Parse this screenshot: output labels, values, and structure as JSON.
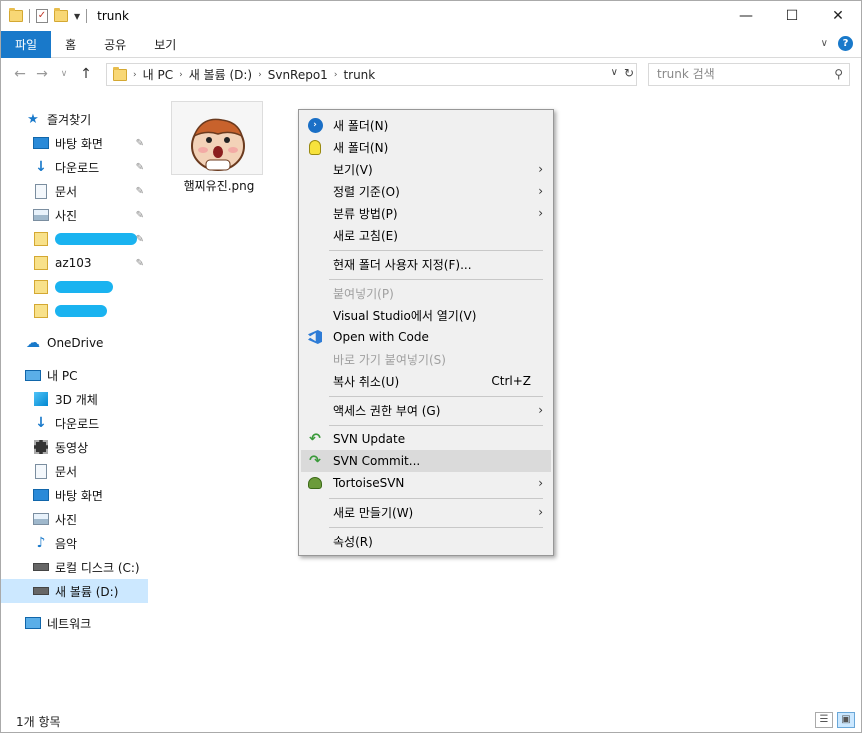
{
  "window": {
    "title": "trunk",
    "controls": {
      "minimize": "—",
      "maximize": "☐",
      "close": "✕"
    }
  },
  "ribbon": {
    "tabs": [
      {
        "label": "파일",
        "active": true
      },
      {
        "label": "홈"
      },
      {
        "label": "공유"
      },
      {
        "label": "보기"
      }
    ],
    "help_label": "?"
  },
  "address": {
    "path": [
      "내 PC",
      "새 볼륨 (D:)",
      "SvnRepo1",
      "trunk"
    ]
  },
  "search": {
    "placeholder": "trunk 검색"
  },
  "sidebar": {
    "quick_access": "즐겨찾기",
    "quick_items": [
      {
        "label": "바탕 화면",
        "icon": "desktop-icon",
        "pinned": true
      },
      {
        "label": "다운로드",
        "icon": "download-icon",
        "pinned": true
      },
      {
        "label": "문서",
        "icon": "document-icon",
        "pinned": true
      },
      {
        "label": "사진",
        "icon": "picture-icon",
        "pinned": true
      },
      {
        "label": "",
        "icon": "folder-icon",
        "pinned": true
      },
      {
        "label": "az103",
        "icon": "folder-icon",
        "pinned": true
      },
      {
        "label": "",
        "icon": "folder-icon"
      },
      {
        "label": "",
        "icon": "folder-icon"
      }
    ],
    "onedrive": "OneDrive",
    "this_pc": "내 PC",
    "pc_items": [
      {
        "label": "3D 개체",
        "icon": "3d-objects-icon"
      },
      {
        "label": "다운로드",
        "icon": "download-icon"
      },
      {
        "label": "동영상",
        "icon": "video-icon"
      },
      {
        "label": "문서",
        "icon": "document-icon"
      },
      {
        "label": "바탕 화면",
        "icon": "desktop-icon"
      },
      {
        "label": "사진",
        "icon": "picture-icon"
      },
      {
        "label": "음악",
        "icon": "music-icon"
      },
      {
        "label": "로컬 디스크 (C:)",
        "icon": "drive-icon"
      },
      {
        "label": "새 볼륨 (D:)",
        "icon": "drive-icon",
        "selected": true
      }
    ],
    "network": "네트워크"
  },
  "content": {
    "files": [
      {
        "name": "햄찌유진.png"
      }
    ]
  },
  "context_menu": {
    "items": [
      {
        "label": "새 폴더(N)",
        "icon": "powershell-icon"
      },
      {
        "label": "새 폴더(N)",
        "icon": "bulb-icon"
      },
      {
        "label": "보기(V)",
        "submenu": true
      },
      {
        "label": "정렬 기준(O)",
        "submenu": true
      },
      {
        "label": "분류 방법(P)",
        "submenu": true
      },
      {
        "label": "새로 고침(E)"
      },
      {
        "label": "현재 폴더 사용자 지정(F)..."
      },
      {
        "label": "붙여넣기(P)",
        "disabled": true
      },
      {
        "label": "Visual Studio에서 열기(V)"
      },
      {
        "label": "Open with Code",
        "icon": "vscode-icon"
      },
      {
        "label": "바로 가기 붙여넣기(S)",
        "disabled": true
      },
      {
        "label": "복사 취소(U)",
        "shortcut": "Ctrl+Z"
      },
      {
        "label": "액세스 권한 부여 (G)",
        "submenu": true
      },
      {
        "label": "SVN Update",
        "icon": "svn-update-icon"
      },
      {
        "label": "SVN Commit...",
        "icon": "svn-commit-icon",
        "highlighted": true
      },
      {
        "label": "TortoiseSVN",
        "icon": "tortoise-icon",
        "submenu": true
      },
      {
        "label": "새로 만들기(W)",
        "submenu": true
      },
      {
        "label": "속성(R)"
      }
    ],
    "submenu_arrow": "›"
  },
  "status": {
    "text": "1개 항목"
  },
  "colors": {
    "accent": "#1979ca",
    "menu_bg": "#f0f0f0",
    "menu_highlight": "#dadada"
  }
}
